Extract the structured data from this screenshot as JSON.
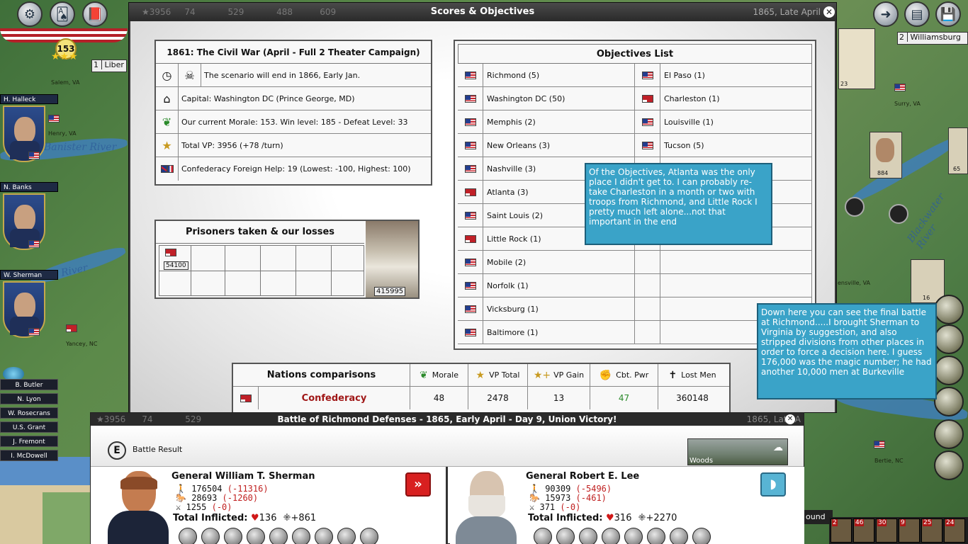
{
  "topbar": {
    "morale_value": "153",
    "strip_values": [
      "3956",
      "74",
      "529",
      "488",
      "609"
    ],
    "date": "1865, Late April",
    "sidebar_label": "Liber",
    "sidebar_number": "1",
    "right_box_number": "2",
    "right_box_label": "Williamsburg"
  },
  "map": {
    "towns": [
      "Salem, VA",
      "Henry, VA",
      "Surry, VA",
      "Yancey, NC",
      "Bertie, NC",
      "ensville, VA"
    ],
    "rivers": [
      "Banister River",
      "River",
      "Blackwater River"
    ],
    "unit_counts": [
      "23",
      "884",
      "65",
      "16"
    ]
  },
  "sidebar": {
    "generals": [
      "H. Halleck",
      "N. Banks",
      "W. Sherman"
    ],
    "roster": [
      "B. Butler",
      "N. Lyon",
      "W. Rosecrans",
      "U.S. Grant",
      "J. Fremont",
      "I. McDowell"
    ]
  },
  "scores": {
    "window_title": "Scores & Objectives",
    "scenario_title": "1861: The Civil War (April - Full 2 Theater Campaign)",
    "rows": [
      {
        "icon": "clock-icon",
        "text": "The scenario will end in 1866, Early Jan."
      },
      {
        "icon": "capitol-icon",
        "text": "Capital: Washington DC (Prince George, MD)"
      },
      {
        "icon": "laurel-icon",
        "text": "Our current Morale: 153. Win level: 185 - Defeat Level: 33"
      },
      {
        "icon": "star-icon",
        "text": "Total VP: 3956 (+78 /turn)"
      },
      {
        "icon": "foreign-flags-icon",
        "text": "Confederacy Foreign Help: 19  (Lowest: -100, Highest: 100)"
      }
    ],
    "prisoners_title": "Prisoners taken & our losses",
    "prisoners_value": "54100",
    "losses_value": "415995"
  },
  "objectives": {
    "title": "Objectives List",
    "left": [
      {
        "name": "Richmond (5)",
        "flag": "us"
      },
      {
        "name": "Washington DC (50)",
        "flag": "us"
      },
      {
        "name": "Memphis (2)",
        "flag": "us"
      },
      {
        "name": "New Orleans (3)",
        "flag": "us"
      },
      {
        "name": "Nashville (3)",
        "flag": "us"
      },
      {
        "name": "Atlanta (3)",
        "flag": "cs"
      },
      {
        "name": "Saint Louis (2)",
        "flag": "us"
      },
      {
        "name": "Little Rock (1)",
        "flag": "cs"
      },
      {
        "name": "Mobile (2)",
        "flag": "us"
      },
      {
        "name": "Norfolk (1)",
        "flag": "us"
      },
      {
        "name": "Vicksburg (1)",
        "flag": "us"
      },
      {
        "name": "Baltimore (1)",
        "flag": "us"
      }
    ],
    "right": [
      {
        "name": "El Paso (1)",
        "flag": "us"
      },
      {
        "name": "Charleston (1)",
        "flag": "cs"
      },
      {
        "name": "Louisville (1)",
        "flag": "us"
      },
      {
        "name": "Tucson (5)",
        "flag": "us"
      }
    ]
  },
  "annotations": {
    "objectives_note": "Of the Objectives, Atlanta was the only place I didn't get to.  I can probably re-take Charleston in a month or two with troops from Richmond, and Little Rock I pretty much left alone...not that important in the end",
    "battle_note": "Down here you can see the final battle at Richmond.....I brought Sherman to Virginia by suggestion, and also stripped divisions from other places in order to force a decision here.  I guess 176,000 was the magic number; he had another 10,000 men at Burkeville"
  },
  "nations": {
    "title": "Nations comparisons",
    "headers": [
      "Morale",
      "VP Total",
      "VP Gain",
      "Cbt. Pwr",
      "Lost Men"
    ],
    "row": {
      "name": "Confederacy",
      "morale": "48",
      "vp_total": "2478",
      "vp_gain": "13",
      "cbt_pwr": "47",
      "lost_men": "360148"
    }
  },
  "battle": {
    "title": "Battle of Richmond Defenses - 1865, Early April - Day 9, Union Victory!",
    "strip_values": [
      "3956",
      "74",
      "529"
    ],
    "strip_date": "1865, Late A",
    "result_label": "Battle Result",
    "result_badge": "E",
    "terrain": "Woods",
    "union": {
      "general": "General William T. Sherman",
      "infantry": "176504",
      "infantry_loss": "(-11316)",
      "cavalry": "28693",
      "cavalry_loss": "(-1260)",
      "artillery": "1255",
      "artillery_loss": "(-0)",
      "inflicted_label": "Total Inflicted:",
      "hits": "136",
      "damage": "+861"
    },
    "confederate": {
      "general": "General Robert E. Lee",
      "infantry": "90309",
      "infantry_loss": "(-5496)",
      "cavalry": "15973",
      "cavalry_loss": "(-461)",
      "artillery": "371",
      "artillery_loss": "(-0)",
      "inflicted_label": "Total Inflicted:",
      "hits": "316",
      "damage": "+2270"
    }
  },
  "bottom_right": {
    "label": "ound",
    "counts": [
      "2",
      "46",
      "30",
      "9",
      "25",
      "24"
    ]
  }
}
